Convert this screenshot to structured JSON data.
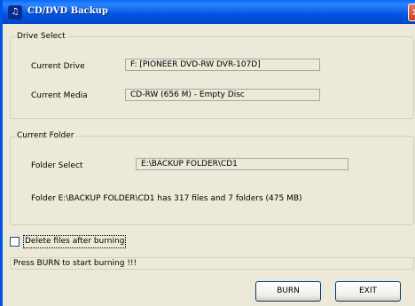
{
  "window": {
    "title": "CD/DVD Backup",
    "close_glyph": "✕",
    "icon": "app-icon"
  },
  "drive_select": {
    "legend": "Drive Select",
    "current_drive_label": "Current Drive",
    "current_drive_value": "F: [PIONEER  DVD-RW  DVR-107D]",
    "current_media_label": "Current Media",
    "current_media_value": "CD-RW (656 M) -  Empty Disc"
  },
  "current_folder": {
    "legend": "Current Folder",
    "folder_select_label": "Folder Select",
    "folder_select_value": "E:\\BACKUP FOLDER\\CD1",
    "info": "Folder E:\\BACKUP FOLDER\\CD1 has 317 files and 7 folders (475 MB)"
  },
  "options": {
    "delete_after_burn_label": "Delete files after burning",
    "delete_after_burn_checked": false
  },
  "status": "Press BURN to start burning !!!",
  "buttons": {
    "burn": "BURN",
    "exit": "EXIT"
  }
}
